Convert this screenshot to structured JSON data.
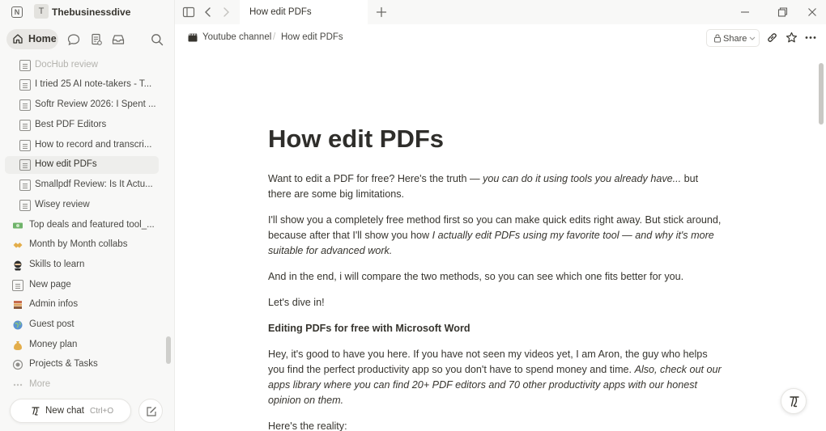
{
  "workspace": {
    "initial": "T",
    "name": "Thebusinessdive"
  },
  "nav": {
    "home_label": "Home"
  },
  "sidebar": {
    "items": [
      {
        "label": "DocHub review",
        "icon": "doc-icon",
        "faded": true
      },
      {
        "label": "I tried 25 AI note-takers - T...",
        "icon": "doc-icon"
      },
      {
        "label": "Softr Review 2026: I Spent ...",
        "icon": "doc-icon"
      },
      {
        "label": "Best PDF Editors",
        "icon": "doc-icon"
      },
      {
        "label": "How to record and transcri...",
        "icon": "doc-icon"
      },
      {
        "label": "How edit PDFs",
        "icon": "doc-icon",
        "active": true
      },
      {
        "label": "Smallpdf Review: Is It Actu...",
        "icon": "doc-icon"
      },
      {
        "label": "Wisey review",
        "icon": "doc-icon"
      },
      {
        "label": "Top deals and featured tool_...",
        "icon": "money-emoji-icon",
        "color": "#5aa05a"
      },
      {
        "label": "Month by Month collabs",
        "icon": "handshake-emoji-icon",
        "color": "#d9a441"
      },
      {
        "label": "Skills to learn",
        "icon": "ninja-emoji-icon",
        "color": "#333333"
      },
      {
        "label": "New page",
        "icon": "doc-icon"
      },
      {
        "label": "Admin infos",
        "icon": "books-emoji-icon",
        "color": "#c0634a"
      },
      {
        "label": "Guest post",
        "icon": "globe-emoji-icon",
        "color": "#4a86c8"
      },
      {
        "label": "Money plan",
        "icon": "moneybag-emoji-icon",
        "color": "#d9a441"
      },
      {
        "label": "Projects & Tasks",
        "icon": "target-icon",
        "color": "#8f8e8a"
      },
      {
        "label": "More",
        "icon": "more-icon",
        "faded": true
      }
    ]
  },
  "new_chat": {
    "label": "New chat",
    "shortcut": "Ctrl+O"
  },
  "tab": {
    "title": "How edit PDFs"
  },
  "breadcrumb": {
    "parent": "Youtube channel",
    "separator": "/",
    "current": "How edit PDFs"
  },
  "share": {
    "label": "Share"
  },
  "page": {
    "title": "How edit PDFs",
    "p1_a": "Want to edit a PDF for free? Here's the truth — ",
    "p1_em": "you can do it using tools you already have...",
    "p1_b": " but there are some big limitations.",
    "p2_a": "I'll show you a completely free method first so you can make quick edits right away. But stick around, because after that I'll show you how ",
    "p2_em": "I actually edit PDFs using my favorite tool — and why it's more suitable for advanced work.",
    "p3": "And in the end, i will compare the two methods, so you can see which one fits better for you.",
    "p4": "Let's dive in!",
    "h2": "Editing PDFs for free with Microsoft Word",
    "p5_a": "Hey, it's good to have you here. If you have not seen my videos yet, I am Aron, the guy who helps you find the perfect productivity app so you don't have to spend money and time. ",
    "p5_em": "Also, check out our apps library where you can find 20+ PDF editors and 70 other productivity apps with our honest opinion on them.",
    "p6": "Here's the reality:"
  }
}
